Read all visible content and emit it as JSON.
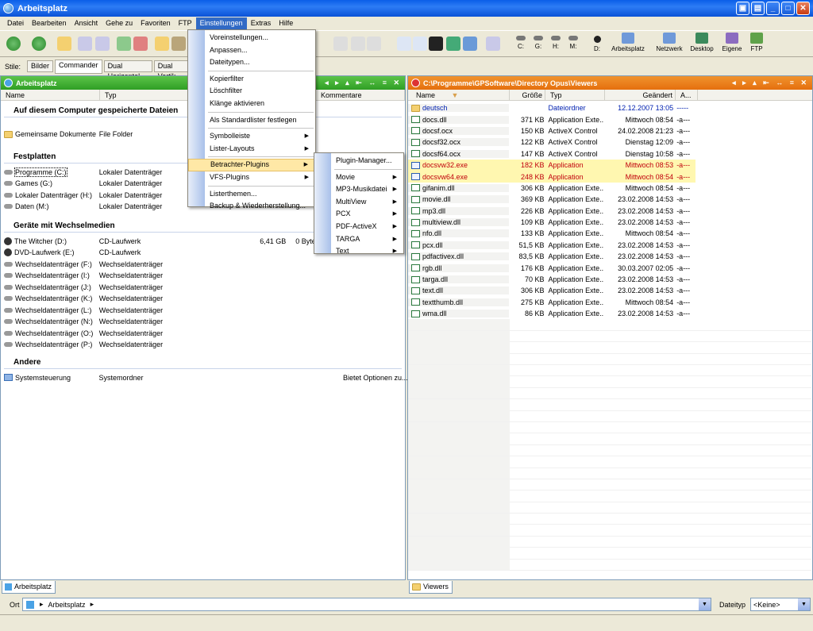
{
  "window": {
    "title": "Arbeitsplatz"
  },
  "menubar": [
    "Datei",
    "Bearbeiten",
    "Ansicht",
    "Gehe zu",
    "Favoriten",
    "FTP",
    "Einstellungen",
    "Extras",
    "Hilfe"
  ],
  "toolbar": {
    "drives": [
      "C:",
      "G:",
      "H:",
      "M:",
      "D:"
    ],
    "shortcuts": [
      "Arbeitsplatz",
      "Netzwerk",
      "Desktop",
      "Eigene",
      "FTP"
    ]
  },
  "stylebar": {
    "label": "Stile:",
    "tabs": [
      "Bilder",
      "Commander",
      "Dual Horizontal",
      "Dual Vertik"
    ]
  },
  "left_pane": {
    "title": "Arbeitsplatz",
    "columns": [
      "Name",
      "Typ",
      "Kommentare"
    ],
    "groups": [
      {
        "label": "Auf diesem Computer gespeicherte Dateien",
        "items": [
          {
            "name": "Gemeinsame Dokumente",
            "type": "File Folder",
            "size": "",
            "free": "",
            "icon": "folder",
            "comment": ""
          }
        ]
      },
      {
        "label": "Festplatten",
        "items": [
          {
            "name": "Programme (C:)",
            "type": "Lokaler Datenträger",
            "size": "",
            "free": "",
            "icon": "drive",
            "comment": ""
          },
          {
            "name": "Games (G:)",
            "type": "Lokaler Datenträger",
            "size": "",
            "free": "",
            "icon": "drive",
            "comment": ""
          },
          {
            "name": "Lokaler Datenträger (H:)",
            "type": "Lokaler Datenträger",
            "size": "",
            "free": "",
            "icon": "drive",
            "comment": ""
          },
          {
            "name": "Daten (M:)",
            "type": "Lokaler Datenträger",
            "size": "",
            "free": "",
            "icon": "drive",
            "comment": ""
          }
        ]
      },
      {
        "label": "Geräte mit Wechselmedien",
        "items": [
          {
            "name": "The Witcher (D:)",
            "type": "CD-Laufwerk",
            "size": "6,41 GB",
            "free": "0 Byte",
            "icon": "cd",
            "comment": ""
          },
          {
            "name": "DVD-Laufwerk (E:)",
            "type": "CD-Laufwerk",
            "size": "",
            "free": "",
            "icon": "cd",
            "comment": ""
          },
          {
            "name": "Wechseldatenträger (F:)",
            "type": "Wechseldatenträger",
            "size": "",
            "free": "",
            "icon": "drive",
            "comment": ""
          },
          {
            "name": "Wechseldatenträger (I:)",
            "type": "Wechseldatenträger",
            "size": "",
            "free": "",
            "icon": "drive",
            "comment": ""
          },
          {
            "name": "Wechseldatenträger (J:)",
            "type": "Wechseldatenträger",
            "size": "",
            "free": "",
            "icon": "drive",
            "comment": ""
          },
          {
            "name": "Wechseldatenträger (K:)",
            "type": "Wechseldatenträger",
            "size": "",
            "free": "",
            "icon": "drive",
            "comment": ""
          },
          {
            "name": "Wechseldatenträger (L:)",
            "type": "Wechseldatenträger",
            "size": "",
            "free": "",
            "icon": "drive",
            "comment": ""
          },
          {
            "name": "Wechseldatenträger (N:)",
            "type": "Wechseldatenträger",
            "size": "",
            "free": "",
            "icon": "drive",
            "comment": ""
          },
          {
            "name": "Wechseldatenträger (O:)",
            "type": "Wechseldatenträger",
            "size": "",
            "free": "",
            "icon": "drive",
            "comment": ""
          },
          {
            "name": "Wechseldatenträger (P:)",
            "type": "Wechseldatenträger",
            "size": "",
            "free": "",
            "icon": "drive",
            "comment": ""
          }
        ]
      },
      {
        "label": "Andere",
        "items": [
          {
            "name": "Systemsteuerung",
            "type": "Systemordner",
            "size": "",
            "free": "",
            "icon": "cp",
            "comment": "Bietet Optionen zu..."
          }
        ]
      }
    ]
  },
  "right_pane": {
    "title": "C:\\Programme\\GPSoftware\\Directory Opus\\Viewers",
    "columns": [
      "Name",
      "Größe",
      "Typ",
      "Geändert",
      "A..."
    ],
    "rows": [
      {
        "name": "deutsch",
        "size": "",
        "type": "Dateiordner",
        "date": "12.12.2007 13:05",
        "attr": "-----",
        "kind": "dir"
      },
      {
        "name": "docs.dll",
        "size": "371 KB",
        "type": "Application Exte...",
        "date": "Mittwoch 08:54",
        "attr": "-a---",
        "kind": "dll"
      },
      {
        "name": "docsf.ocx",
        "size": "150 KB",
        "type": "ActiveX Control",
        "date": "24.02.2008 21:23",
        "attr": "-a---",
        "kind": "dll"
      },
      {
        "name": "docsf32.ocx",
        "size": "122 KB",
        "type": "ActiveX Control",
        "date": "Dienstag 12:09",
        "attr": "-a---",
        "kind": "dll"
      },
      {
        "name": "docsf64.ocx",
        "size": "147 KB",
        "type": "ActiveX Control",
        "date": "Dienstag 10:58",
        "attr": "-a---",
        "kind": "dll"
      },
      {
        "name": "docsvw32.exe",
        "size": "182 KB",
        "type": "Application",
        "date": "Mittwoch 08:53",
        "attr": "-a---",
        "kind": "exe"
      },
      {
        "name": "docsvw64.exe",
        "size": "248 KB",
        "type": "Application",
        "date": "Mittwoch 08:54",
        "attr": "-a---",
        "kind": "exe"
      },
      {
        "name": "gifanim.dll",
        "size": "306 KB",
        "type": "Application Exte...",
        "date": "Mittwoch 08:54",
        "attr": "-a---",
        "kind": "dll"
      },
      {
        "name": "movie.dll",
        "size": "369 KB",
        "type": "Application Exte...",
        "date": "23.02.2008 14:53",
        "attr": "-a---",
        "kind": "dll"
      },
      {
        "name": "mp3.dll",
        "size": "226 KB",
        "type": "Application Exte...",
        "date": "23.02.2008 14:53",
        "attr": "-a---",
        "kind": "dll"
      },
      {
        "name": "multiview.dll",
        "size": "109 KB",
        "type": "Application Exte...",
        "date": "23.02.2008 14:53",
        "attr": "-a---",
        "kind": "dll"
      },
      {
        "name": "nfo.dll",
        "size": "133 KB",
        "type": "Application Exte...",
        "date": "Mittwoch 08:54",
        "attr": "-a---",
        "kind": "dll"
      },
      {
        "name": "pcx.dll",
        "size": "51,5 KB",
        "type": "Application Exte...",
        "date": "23.02.2008 14:53",
        "attr": "-a---",
        "kind": "dll"
      },
      {
        "name": "pdfactivex.dll",
        "size": "83,5 KB",
        "type": "Application Exte...",
        "date": "23.02.2008 14:53",
        "attr": "-a---",
        "kind": "dll"
      },
      {
        "name": "rgb.dll",
        "size": "176 KB",
        "type": "Application Exte...",
        "date": "30.03.2007 02:05",
        "attr": "-a---",
        "kind": "dll"
      },
      {
        "name": "targa.dll",
        "size": "70 KB",
        "type": "Application Exte...",
        "date": "23.02.2008 14:53",
        "attr": "-a---",
        "kind": "dll"
      },
      {
        "name": "text.dll",
        "size": "306 KB",
        "type": "Application Exte...",
        "date": "23.02.2008 14:53",
        "attr": "-a---",
        "kind": "dll"
      },
      {
        "name": "textthumb.dll",
        "size": "275 KB",
        "type": "Application Exte...",
        "date": "Mittwoch 08:54",
        "attr": "-a---",
        "kind": "dll"
      },
      {
        "name": "wma.dll",
        "size": "86 KB",
        "type": "Application Exte...",
        "date": "23.02.2008 14:53",
        "attr": "-a---",
        "kind": "dll"
      }
    ]
  },
  "einstellungen_menu": [
    {
      "label": "Voreinstellungen...",
      "sub": false
    },
    {
      "label": "Anpassen...",
      "sub": false
    },
    {
      "label": "Dateitypen...",
      "sub": false
    },
    {
      "sep": true
    },
    {
      "label": "Kopierfilter",
      "sub": false
    },
    {
      "label": "Löschfilter",
      "sub": false
    },
    {
      "label": "Klänge aktivieren",
      "sub": false
    },
    {
      "sep": true
    },
    {
      "label": "Als Standardlister festlegen",
      "sub": false
    },
    {
      "sep": true
    },
    {
      "label": "Symbolleiste",
      "sub": true
    },
    {
      "label": "Lister-Layouts",
      "sub": true
    },
    {
      "sep": true
    },
    {
      "label": "Betrachter-Plugins",
      "sub": true,
      "highlight": true
    },
    {
      "label": "VFS-Plugins",
      "sub": true
    },
    {
      "sep": true
    },
    {
      "label": "Listerthemen...",
      "sub": false
    },
    {
      "label": "Backup & Wiederherstellung...",
      "sub": false
    }
  ],
  "plugins_submenu": [
    {
      "label": "Plugin-Manager...",
      "sub": false
    },
    {
      "sep": true
    },
    {
      "label": "Movie",
      "sub": true
    },
    {
      "label": "MP3-Musikdatei",
      "sub": true
    },
    {
      "label": "MultiView",
      "sub": true
    },
    {
      "label": "PCX",
      "sub": true
    },
    {
      "label": "PDF-ActiveX",
      "sub": true
    },
    {
      "label": "TARGA",
      "sub": true
    },
    {
      "label": "Text",
      "sub": true
    }
  ],
  "bottom_tabs": {
    "left": "Arbeitsplatz",
    "right": "Viewers"
  },
  "locbar": {
    "label": "Ort",
    "path": "Arbeitsplatz",
    "filetype_label": "Dateityp",
    "filetype_value": "<Keine>"
  }
}
